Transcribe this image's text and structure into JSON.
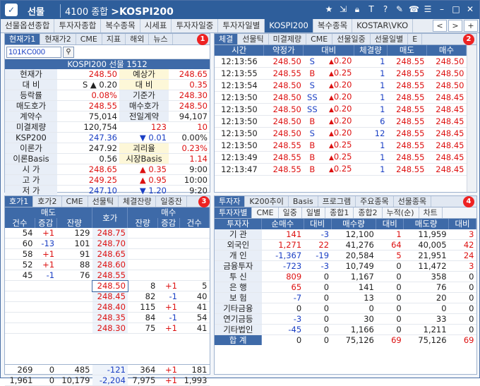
{
  "titlebar": {
    "app": "선물",
    "screen_code": "4100 종합",
    "screen_sep": ">",
    "screen_name": "KOSPI200",
    "icons": [
      "star-icon",
      "export-icon",
      "lock-icon",
      "font-icon",
      "help-icon",
      "tools-icon",
      "phone-icon",
      "menu-icon",
      "minimize-icon",
      "maximize-icon",
      "close-icon"
    ]
  },
  "tabs": [
    "선물옵션종합",
    "투자자종합",
    "복수종목",
    "시세표",
    "투자자일중",
    "투자자일별",
    "KOSPI200",
    "복수종목",
    "KOSTAR\\VKO"
  ],
  "active_tab": "KOSPI200",
  "tabnav": {
    "prev": "<",
    "next": ">",
    "add": "+"
  },
  "quote": {
    "tabs": [
      "현재가1",
      "현재가2",
      "CME",
      "지표",
      "해외",
      "뉴스"
    ],
    "active": "현재가1",
    "badge": "1",
    "code": "101KC000",
    "title": "KOSPI200 선물 1512",
    "rows": [
      [
        "현재가",
        "248.50",
        "예상가",
        "248.65"
      ],
      [
        "대  비",
        "S ▲ 0.20",
        "대  비",
        "0.35"
      ],
      [
        "등락률",
        "0.08%",
        "기준가",
        "248.30"
      ],
      [
        "매도호가",
        "248.55",
        "매수호가",
        "248.50"
      ],
      [
        "계약수",
        "75,014",
        "전일계약",
        "94,107"
      ],
      [
        "미결제량",
        "120,754",
        "123",
        "10"
      ],
      [
        "KSP200",
        "247.36",
        "▼ 0.01",
        "0.00%"
      ],
      [
        "이론가",
        "247.92",
        "괴리율",
        "0.23%"
      ],
      [
        "이론Basis",
        "0.56",
        "시장Basis",
        "1.14"
      ],
      [
        "시  가",
        "248.65",
        "▲ 0.35",
        "9:00"
      ],
      [
        "고  가",
        "249.25",
        "▲ 0.95",
        "10:00"
      ],
      [
        "저  가",
        "247.10",
        "▼ 1.20",
        "9:20"
      ]
    ]
  },
  "ticks": {
    "tabs": [
      "체결",
      "선물틱",
      "미결제량",
      "CME",
      "선물일중",
      "선물일별",
      "E"
    ],
    "active": "체결",
    "badge": "2",
    "headers": [
      "시간",
      "약정가",
      "대비",
      "체결량",
      "매도",
      "매수"
    ],
    "rows": [
      [
        "12:13:56",
        "248.50",
        "S",
        "0.20",
        "1",
        "248.55",
        "248.50"
      ],
      [
        "12:13:55",
        "248.55",
        "B",
        "0.25",
        "1",
        "248.55",
        "248.50"
      ],
      [
        "12:13:54",
        "248.50",
        "S",
        "0.20",
        "1",
        "248.55",
        "248.50"
      ],
      [
        "12:13:50",
        "248.50",
        "SS",
        "0.20",
        "1",
        "248.55",
        "248.45"
      ],
      [
        "12:13:50",
        "248.50",
        "SS",
        "0.20",
        "1",
        "248.55",
        "248.45"
      ],
      [
        "12:13:50",
        "248.50",
        "B",
        "0.20",
        "6",
        "248.55",
        "248.45"
      ],
      [
        "12:13:50",
        "248.50",
        "S",
        "0.20",
        "12",
        "248.55",
        "248.45"
      ],
      [
        "12:13:50",
        "248.55",
        "B",
        "0.25",
        "1",
        "248.55",
        "248.45"
      ],
      [
        "12:13:49",
        "248.55",
        "B",
        "0.25",
        "1",
        "248.55",
        "248.45"
      ],
      [
        "12:13:47",
        "248.55",
        "B",
        "0.25",
        "1",
        "248.55",
        "248.45"
      ]
    ]
  },
  "book": {
    "tabs": [
      "호가1",
      "호가2",
      "CME",
      "선물틱",
      "체결잔량",
      "일중잔"
    ],
    "active": "호가1",
    "badge": "3",
    "headers": {
      "sell": "매도",
      "price": "호가",
      "buy": "매수",
      "cols": [
        "건수",
        "증감",
        "잔량",
        "잔량",
        "증감",
        "건수"
      ]
    },
    "asks": [
      [
        "54",
        "+1",
        "129",
        "248.75"
      ],
      [
        "60",
        "-13",
        "101",
        "248.70"
      ],
      [
        "58",
        "+1",
        "91",
        "248.65"
      ],
      [
        "52",
        "+1",
        "88",
        "248.60"
      ],
      [
        "45",
        "-1",
        "76",
        "248.55"
      ]
    ],
    "bids": [
      [
        "248.50",
        "8",
        "+1",
        "5"
      ],
      [
        "248.45",
        "82",
        "-1",
        "40"
      ],
      [
        "248.40",
        "115",
        "+1",
        "41"
      ],
      [
        "248.35",
        "84",
        "-1",
        "54"
      ],
      [
        "248.30",
        "75",
        "+1",
        "41"
      ]
    ],
    "total1": [
      "269",
      "0",
      "485",
      "-121",
      "364",
      "+1",
      "181"
    ],
    "total2": [
      "1,961",
      "0",
      "10,179",
      "-2,204",
      "7,975",
      "+1",
      "1,993"
    ]
  },
  "investors": {
    "tabs": [
      "투자자",
      "K200추이",
      "Basis",
      "프로그램",
      "주요종목",
      "선물종목"
    ],
    "active": "투자자",
    "badge": "4",
    "subtabs": [
      "투자자별",
      "CME",
      "일중",
      "일별",
      "종합1",
      "종합2",
      "누적(순)",
      "차트"
    ],
    "headers": [
      "투자자",
      "순매수",
      "대비",
      "매수량",
      "대비",
      "매도량",
      "대비"
    ],
    "rows": [
      [
        "기  관",
        "141",
        "-3",
        "12,100",
        "1",
        "11,959",
        "3"
      ],
      [
        "외국인",
        "1,271",
        "22",
        "41,276",
        "64",
        "40,005",
        "42"
      ],
      [
        "개  인",
        "-1,367",
        "-19",
        "20,584",
        "5",
        "21,951",
        "24"
      ],
      [
        "금융투자",
        "-723",
        "-3",
        "10,749",
        "0",
        "11,472",
        "3"
      ],
      [
        "투  신",
        "809",
        "0",
        "1,167",
        "0",
        "358",
        "0"
      ],
      [
        "은  행",
        "65",
        "0",
        "141",
        "0",
        "76",
        "0"
      ],
      [
        "보  험",
        "-7",
        "0",
        "13",
        "0",
        "20",
        "0"
      ],
      [
        "기타금융",
        "0",
        "0",
        "0",
        "0",
        "0",
        "0"
      ],
      [
        "연기금등",
        "-3",
        "0",
        "30",
        "0",
        "33",
        "0"
      ],
      [
        "기타법인",
        "-45",
        "0",
        "1,166",
        "0",
        "1,211",
        "0"
      ]
    ],
    "total": [
      "합  계",
      "0",
      "0",
      "75,126",
      "69",
      "75,126",
      "69"
    ]
  }
}
